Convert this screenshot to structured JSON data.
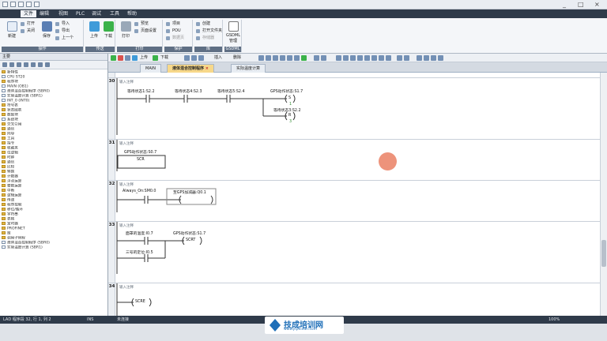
{
  "titlebar": {
    "controls": [
      "_",
      "□",
      "×"
    ]
  },
  "menu": {
    "items": [
      "文件",
      "编辑",
      "视图",
      "PLC",
      "调试",
      "工具",
      "帮助"
    ],
    "active_index": 0
  },
  "ribbon": {
    "groups": [
      {
        "label": "操作",
        "buttons": [
          "新建",
          "打开",
          "关闭",
          "保存",
          "导入",
          "导出",
          "上一个"
        ]
      },
      {
        "label": "传送",
        "buttons": [
          "上传",
          "下载"
        ]
      },
      {
        "label": "打印",
        "buttons": [
          "打印",
          "预览",
          "页面设置"
        ]
      },
      {
        "label": "保护",
        "buttons": [
          "项目",
          "POU",
          "数据页"
        ]
      },
      {
        "label": "库",
        "buttons": [
          "创建",
          "打开文件夹",
          "存储器"
        ]
      },
      {
        "label": "GSDML",
        "buttons": [
          "GSDML 管理"
        ]
      }
    ]
  },
  "leftpane": {
    "header": "主要",
    "tree": [
      {
        "text": "新特性",
        "type": "folder"
      },
      {
        "text": "CPU ST20",
        "type": "doc"
      },
      {
        "text": "程序块",
        "type": "folder"
      },
      {
        "text": "MAIN (OB1)",
        "type": "doc"
      },
      {
        "text": "液体混合控制程序 (SBR0)",
        "type": "doc"
      },
      {
        "text": "实际温度计算 (SBR1)",
        "type": "doc"
      },
      {
        "text": "INT_0 (INT0)",
        "type": "doc"
      },
      {
        "text": "符号表",
        "type": "folder"
      },
      {
        "text": "状态图表",
        "type": "folder"
      },
      {
        "text": "数据块",
        "type": "folder"
      },
      {
        "text": "系统块",
        "type": "doc"
      },
      {
        "text": "交叉引用",
        "type": "folder"
      },
      {
        "text": "通信",
        "type": "folder"
      },
      {
        "text": "向导",
        "type": "folder"
      },
      {
        "text": "工具",
        "type": "folder"
      },
      {
        "text": "指令",
        "type": "folder"
      },
      {
        "text": "收藏夹",
        "type": "folder"
      },
      {
        "text": "位逻辑",
        "type": "folder"
      },
      {
        "text": "时钟",
        "type": "folder"
      },
      {
        "text": "通信",
        "type": "folder"
      },
      {
        "text": "比较",
        "type": "folder"
      },
      {
        "text": "转换",
        "type": "folder"
      },
      {
        "text": "计数器",
        "type": "folder"
      },
      {
        "text": "浮点运算",
        "type": "folder"
      },
      {
        "text": "整数运算",
        "type": "folder"
      },
      {
        "text": "中断",
        "type": "folder"
      },
      {
        "text": "逻辑运算",
        "type": "folder"
      },
      {
        "text": "传送",
        "type": "folder"
      },
      {
        "text": "程序控制",
        "type": "folder"
      },
      {
        "text": "移位/循环",
        "type": "folder"
      },
      {
        "text": "字符串",
        "type": "folder"
      },
      {
        "text": "表格",
        "type": "folder"
      },
      {
        "text": "定时器",
        "type": "folder"
      },
      {
        "text": "PROFINET",
        "type": "folder"
      },
      {
        "text": "库",
        "type": "folder"
      },
      {
        "text": "调用子例程",
        "type": "folder"
      },
      {
        "text": "液体混合控制程序 (SBR0)",
        "type": "doc"
      },
      {
        "text": "实际温度计算 (SBR1)",
        "type": "doc"
      }
    ]
  },
  "toolbar2": {
    "upload": "上传",
    "download": "下载",
    "insert": "插入",
    "delete": "删除"
  },
  "tabs": [
    {
      "label": "MAIN",
      "active": false
    },
    {
      "label": "液体混合控制程序",
      "active": true
    },
    {
      "label": "实际温度计算",
      "active": false
    }
  ],
  "networks": [
    {
      "number": "30",
      "comment": "输入注释",
      "contacts": [
        "等待状态1:S2.2",
        "等待状态4:S2.3",
        "等待状态5:S2.4"
      ],
      "coils": [
        {
          "symbol": "GPS动作状态:S1.7",
          "op": "S",
          "n": "1"
        },
        {
          "symbol": "等待状态3:S2.2",
          "op": "R",
          "n": "3"
        }
      ]
    },
    {
      "number": "31",
      "comment": "输入注释",
      "box_symbol": "GPS动作状态:S0.7",
      "box_op": "SCR"
    },
    {
      "number": "32",
      "comment": "输入注释",
      "contact": "Always_On:SM0.0",
      "coil": "至GPS加减器:Q0.1"
    },
    {
      "number": "33",
      "comment": "输入注释",
      "contacts": [
        "面罩的温度:I0.7",
        "三号的定位:I0.5"
      ],
      "coil_symbol": "GPS动作状态:S1.7",
      "coil_op": "SCRT"
    },
    {
      "number": "34",
      "comment": "输入注释",
      "coil_op": "SCRE"
    }
  ],
  "status": {
    "left": "LAD 程序段 32, 行 1, 列 2",
    "mode": "INS",
    "conn": "未连接",
    "zoom": "100%"
  },
  "logo": {
    "text": "技成培训网",
    "url": "www.jcpeixun.com"
  }
}
